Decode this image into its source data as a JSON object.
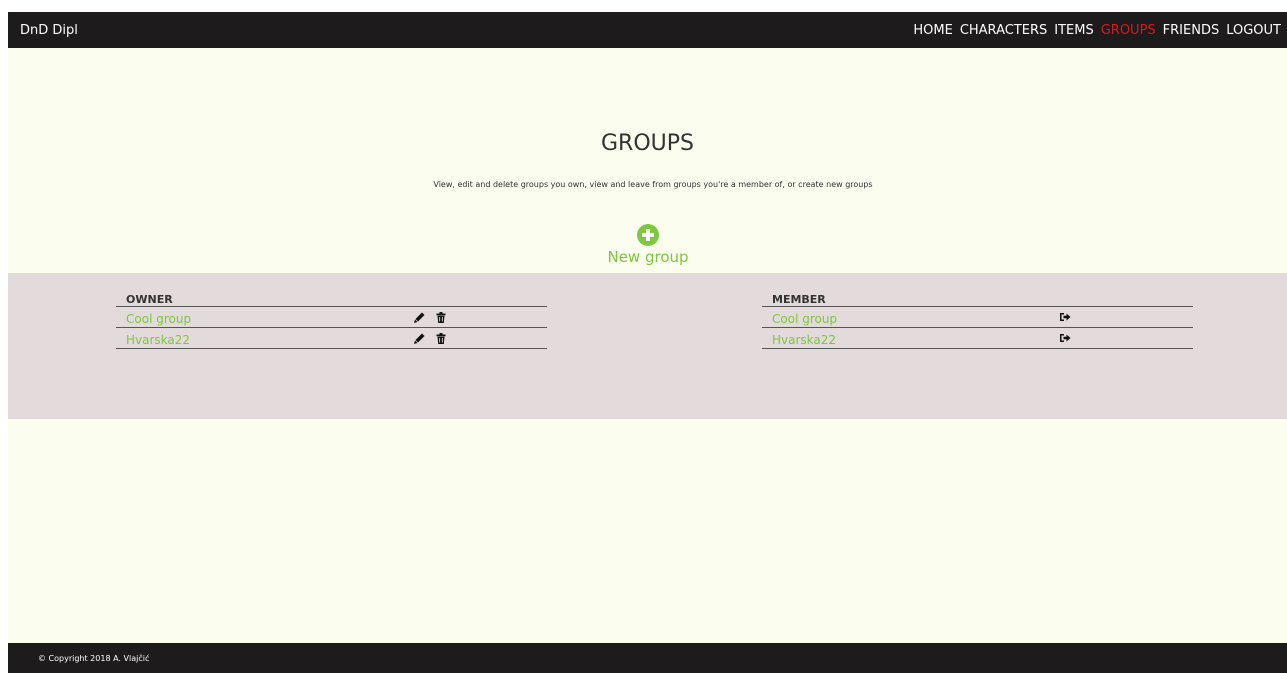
{
  "nav": {
    "brand": "DnD Dipl",
    "links": [
      "HOME",
      "CHARACTERS",
      "ITEMS",
      "GROUPS",
      "FRIENDS",
      "LOGOUT"
    ],
    "active": "GROUPS"
  },
  "page": {
    "title": "GROUPS",
    "subtitle": "View, edit and delete groups you own, view and leave from groups you're a member of, or create new groups",
    "new_group_label": "New group"
  },
  "owner": {
    "header": "OWNER",
    "groups": [
      "Cool group",
      "Hvarska22"
    ]
  },
  "member": {
    "header": "MEMBER",
    "groups": [
      "Cool group",
      "Hvarska22"
    ]
  },
  "footer": {
    "copyright": "© Copyright 2018 A. Vlajčić"
  },
  "colors": {
    "accent": "#7cc93d",
    "active_nav": "#d41c1c",
    "navbar_bg": "#1d1b1b",
    "page_bg": "#fbfdee",
    "band_bg": "#e3dadb"
  },
  "icons": {
    "add": "plus-circle-icon",
    "edit": "pencil-icon",
    "delete": "trash-icon",
    "leave": "sign-out-icon"
  }
}
